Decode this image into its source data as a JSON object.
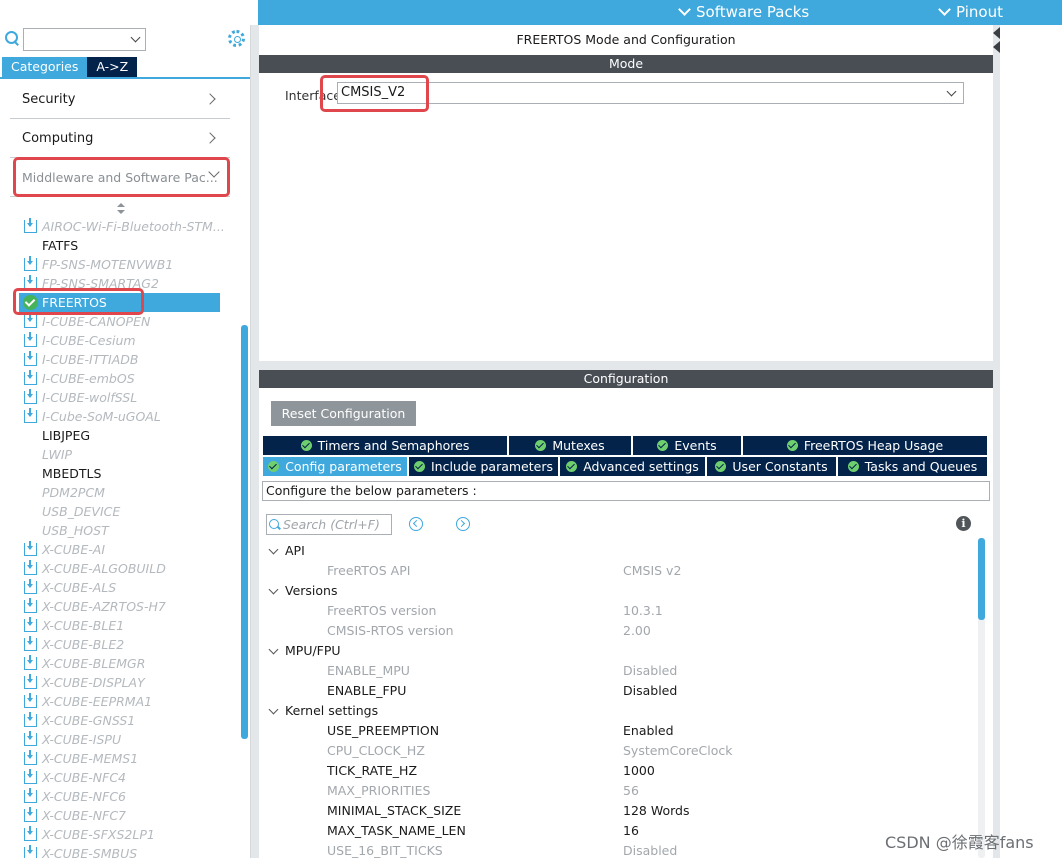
{
  "topbar": {
    "software_packs_label": "Software Packs",
    "pinout_label": "Pinout"
  },
  "left": {
    "search": {
      "value": ""
    },
    "tabs": [
      {
        "label": "Categories",
        "active": true
      },
      {
        "label": "A->Z",
        "active": false
      }
    ],
    "categories": [
      {
        "label": "Security"
      },
      {
        "label": "Computing"
      },
      {
        "label": "Middleware and Software Pac..."
      }
    ],
    "packages": [
      {
        "label": "AIROC-Wi-Fi-Bluetooth-STM...",
        "style": "gray",
        "icon": "download-icon"
      },
      {
        "label": "FATFS",
        "style": "dark",
        "icon": ""
      },
      {
        "label": "FP-SNS-MOTENVWB1",
        "style": "gray",
        "icon": "download-icon"
      },
      {
        "label": "FP-SNS-SMARTAG2",
        "style": "gray",
        "icon": "download-icon"
      },
      {
        "label": "FREERTOS",
        "style": "sel",
        "icon": "check-circle-icon"
      },
      {
        "label": "I-CUBE-CANOPEN",
        "style": "gray",
        "icon": "download-icon"
      },
      {
        "label": "I-CUBE-Cesium",
        "style": "gray",
        "icon": "download-icon"
      },
      {
        "label": "I-CUBE-ITTIADB",
        "style": "gray",
        "icon": "download-icon"
      },
      {
        "label": "I-CUBE-embOS",
        "style": "gray",
        "icon": "download-icon"
      },
      {
        "label": "I-CUBE-wolfSSL",
        "style": "gray",
        "icon": "download-icon"
      },
      {
        "label": "I-Cube-SoM-uGOAL",
        "style": "gray",
        "icon": "download-icon"
      },
      {
        "label": "LIBJPEG",
        "style": "dark",
        "icon": ""
      },
      {
        "label": "LWIP",
        "style": "gray2",
        "icon": ""
      },
      {
        "label": "MBEDTLS",
        "style": "dark",
        "icon": ""
      },
      {
        "label": "PDM2PCM",
        "style": "gray2",
        "icon": ""
      },
      {
        "label": "USB_DEVICE",
        "style": "gray2",
        "icon": ""
      },
      {
        "label": "USB_HOST",
        "style": "gray2",
        "icon": ""
      },
      {
        "label": "X-CUBE-AI",
        "style": "gray",
        "icon": "download-icon"
      },
      {
        "label": "X-CUBE-ALGOBUILD",
        "style": "gray",
        "icon": "download-icon"
      },
      {
        "label": "X-CUBE-ALS",
        "style": "gray",
        "icon": "download-icon"
      },
      {
        "label": "X-CUBE-AZRTOS-H7",
        "style": "gray",
        "icon": "download-icon"
      },
      {
        "label": "X-CUBE-BLE1",
        "style": "gray",
        "icon": "download-icon"
      },
      {
        "label": "X-CUBE-BLE2",
        "style": "gray",
        "icon": "download-icon"
      },
      {
        "label": "X-CUBE-BLEMGR",
        "style": "gray",
        "icon": "download-icon"
      },
      {
        "label": "X-CUBE-DISPLAY",
        "style": "gray",
        "icon": "download-icon"
      },
      {
        "label": "X-CUBE-EEPRMA1",
        "style": "gray",
        "icon": "download-icon"
      },
      {
        "label": "X-CUBE-GNSS1",
        "style": "gray",
        "icon": "download-icon"
      },
      {
        "label": "X-CUBE-ISPU",
        "style": "gray",
        "icon": "download-icon"
      },
      {
        "label": "X-CUBE-MEMS1",
        "style": "gray",
        "icon": "download-icon"
      },
      {
        "label": "X-CUBE-NFC4",
        "style": "gray",
        "icon": "download-icon"
      },
      {
        "label": "X-CUBE-NFC6",
        "style": "gray",
        "icon": "download-icon"
      },
      {
        "label": "X-CUBE-NFC7",
        "style": "gray",
        "icon": "download-icon"
      },
      {
        "label": "X-CUBE-SFXS2LP1",
        "style": "gray",
        "icon": "download-icon"
      },
      {
        "label": "X-CUBE-SMBUS",
        "style": "gray",
        "icon": "download-icon"
      }
    ]
  },
  "main": {
    "title": "FREERTOS Mode and Configuration",
    "mode_header": "Mode",
    "interface_label": "Interface",
    "interface_value": "CMSIS_V2",
    "config_header": "Configuration",
    "reset_label": "Reset Configuration",
    "tabs_row1": [
      {
        "label": "Timers and Semaphores"
      },
      {
        "label": "Mutexes"
      },
      {
        "label": "Events"
      },
      {
        "label": "FreeRTOS Heap Usage"
      }
    ],
    "tabs_row2": [
      {
        "label": "Config parameters",
        "active": true
      },
      {
        "label": "Include parameters"
      },
      {
        "label": "Advanced settings"
      },
      {
        "label": "User Constants"
      },
      {
        "label": "Tasks and Queues"
      }
    ],
    "description": "Configure the below parameters :",
    "search_placeholder": "Search (Ctrl+F)",
    "info_glyph": "i",
    "params": [
      {
        "type": "group",
        "name": "API"
      },
      {
        "type": "param",
        "name": "FreeRTOS API",
        "value": "CMSIS v2",
        "state": "dis"
      },
      {
        "type": "group",
        "name": "Versions"
      },
      {
        "type": "param",
        "name": "FreeRTOS version",
        "value": "10.3.1",
        "state": "dis"
      },
      {
        "type": "param",
        "name": "CMSIS-RTOS version",
        "value": "2.00",
        "state": "dis"
      },
      {
        "type": "group",
        "name": "MPU/FPU"
      },
      {
        "type": "param",
        "name": "ENABLE_MPU",
        "value": "Disabled",
        "state": "dis"
      },
      {
        "type": "param",
        "name": "ENABLE_FPU",
        "value": "Disabled",
        "state": "en"
      },
      {
        "type": "group",
        "name": "Kernel settings"
      },
      {
        "type": "param",
        "name": "USE_PREEMPTION",
        "value": "Enabled",
        "state": "en"
      },
      {
        "type": "param",
        "name": "CPU_CLOCK_HZ",
        "value": "SystemCoreClock",
        "state": "dis"
      },
      {
        "type": "param",
        "name": "TICK_RATE_HZ",
        "value": "1000",
        "state": "en"
      },
      {
        "type": "param",
        "name": "MAX_PRIORITIES",
        "value": "56",
        "state": "dis"
      },
      {
        "type": "param",
        "name": "MINIMAL_STACK_SIZE",
        "value": "128 Words",
        "state": "en"
      },
      {
        "type": "param",
        "name": "MAX_TASK_NAME_LEN",
        "value": "16",
        "state": "en"
      },
      {
        "type": "param",
        "name": "USE_16_BIT_TICKS",
        "value": "Disabled",
        "state": "dis"
      }
    ]
  },
  "watermark": "CSDN @徐霞客fans",
  "colors": {
    "accent": "#3fa8dc",
    "navy": "#03234b",
    "highlight": "#e0474c",
    "ok_green": "#45b35a"
  }
}
